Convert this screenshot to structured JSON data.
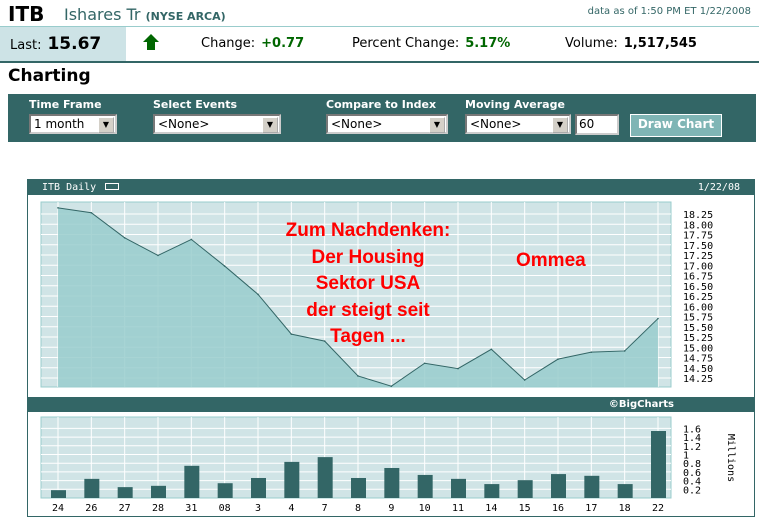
{
  "header": {
    "symbol": "ITB",
    "name": "Ishares Tr",
    "exchange": "(NYSE ARCA)",
    "as_of": "data as of 1:50 PM ET 1/22/2008"
  },
  "quote": {
    "last_label": "Last:",
    "last": "15.67",
    "direction_icon": "up-arrow-icon",
    "change_label": "Change:",
    "change": "+0.77",
    "pct_label": "Percent Change:",
    "pct": "5.17%",
    "volume_label": "Volume:",
    "volume": "1,517,545",
    "up_color": "#006600"
  },
  "section_title": "Charting",
  "form": {
    "time_frame_label": "Time Frame",
    "time_frame": "1 month",
    "events_label": "Select Events",
    "events": "<None>",
    "compare_label": "Compare to Index",
    "compare": "<None>",
    "ma_label": "Moving Average",
    "ma": "<None>",
    "ma_period": "60",
    "draw_label": "Draw Chart"
  },
  "chart_header": {
    "title": "ITB Daily",
    "date": "1/22/08",
    "credit": "©BigCharts"
  },
  "annotations": {
    "main": [
      "Zum Nachdenken:",
      "Der Housing",
      "Sektor USA",
      "der steigt seit",
      "Tagen ..."
    ],
    "author": "Ommea"
  },
  "chart_data": [
    {
      "type": "area",
      "categories": [
        "24",
        "26",
        "27",
        "28",
        "31",
        "08",
        "3",
        "4",
        "7",
        "8",
        "9",
        "10",
        "11",
        "14",
        "15",
        "16",
        "17",
        "18",
        "22"
      ],
      "values": [
        18.4,
        18.28,
        17.67,
        17.24,
        17.63,
        16.98,
        16.29,
        15.32,
        15.15,
        14.3,
        14.05,
        14.61,
        14.48,
        14.95,
        14.2,
        14.71,
        14.88,
        14.91,
        15.7
      ],
      "ylim": [
        14.0,
        18.45
      ],
      "yticks": [
        "18.25",
        "18.00",
        "17.75",
        "17.50",
        "17.25",
        "17.00",
        "16.75",
        "16.50",
        "16.25",
        "16.00",
        "15.75",
        "15.50",
        "15.25",
        "15.00",
        "14.75",
        "14.50",
        "14.25"
      ],
      "grid": true,
      "fill_color": "#99cccc",
      "line_color": "#336666"
    },
    {
      "type": "bar",
      "categories": [
        "24",
        "26",
        "27",
        "28",
        "31",
        "08",
        "3",
        "4",
        "7",
        "8",
        "9",
        "10",
        "11",
        "14",
        "15",
        "16",
        "17",
        "18",
        "22"
      ],
      "values": [
        0.18,
        0.44,
        0.25,
        0.28,
        0.74,
        0.34,
        0.46,
        0.83,
        0.94,
        0.46,
        0.69,
        0.53,
        0.44,
        0.32,
        0.41,
        0.55,
        0.51,
        0.32,
        1.54
      ],
      "ylim": [
        0,
        1.8
      ],
      "yticks": [
        "1.6",
        "1.4",
        "1.2",
        "1",
        "0.8",
        "0.6",
        "0.4",
        "0.2"
      ],
      "ylabel": "Millions",
      "grid": true,
      "bar_color": "#336666"
    }
  ]
}
